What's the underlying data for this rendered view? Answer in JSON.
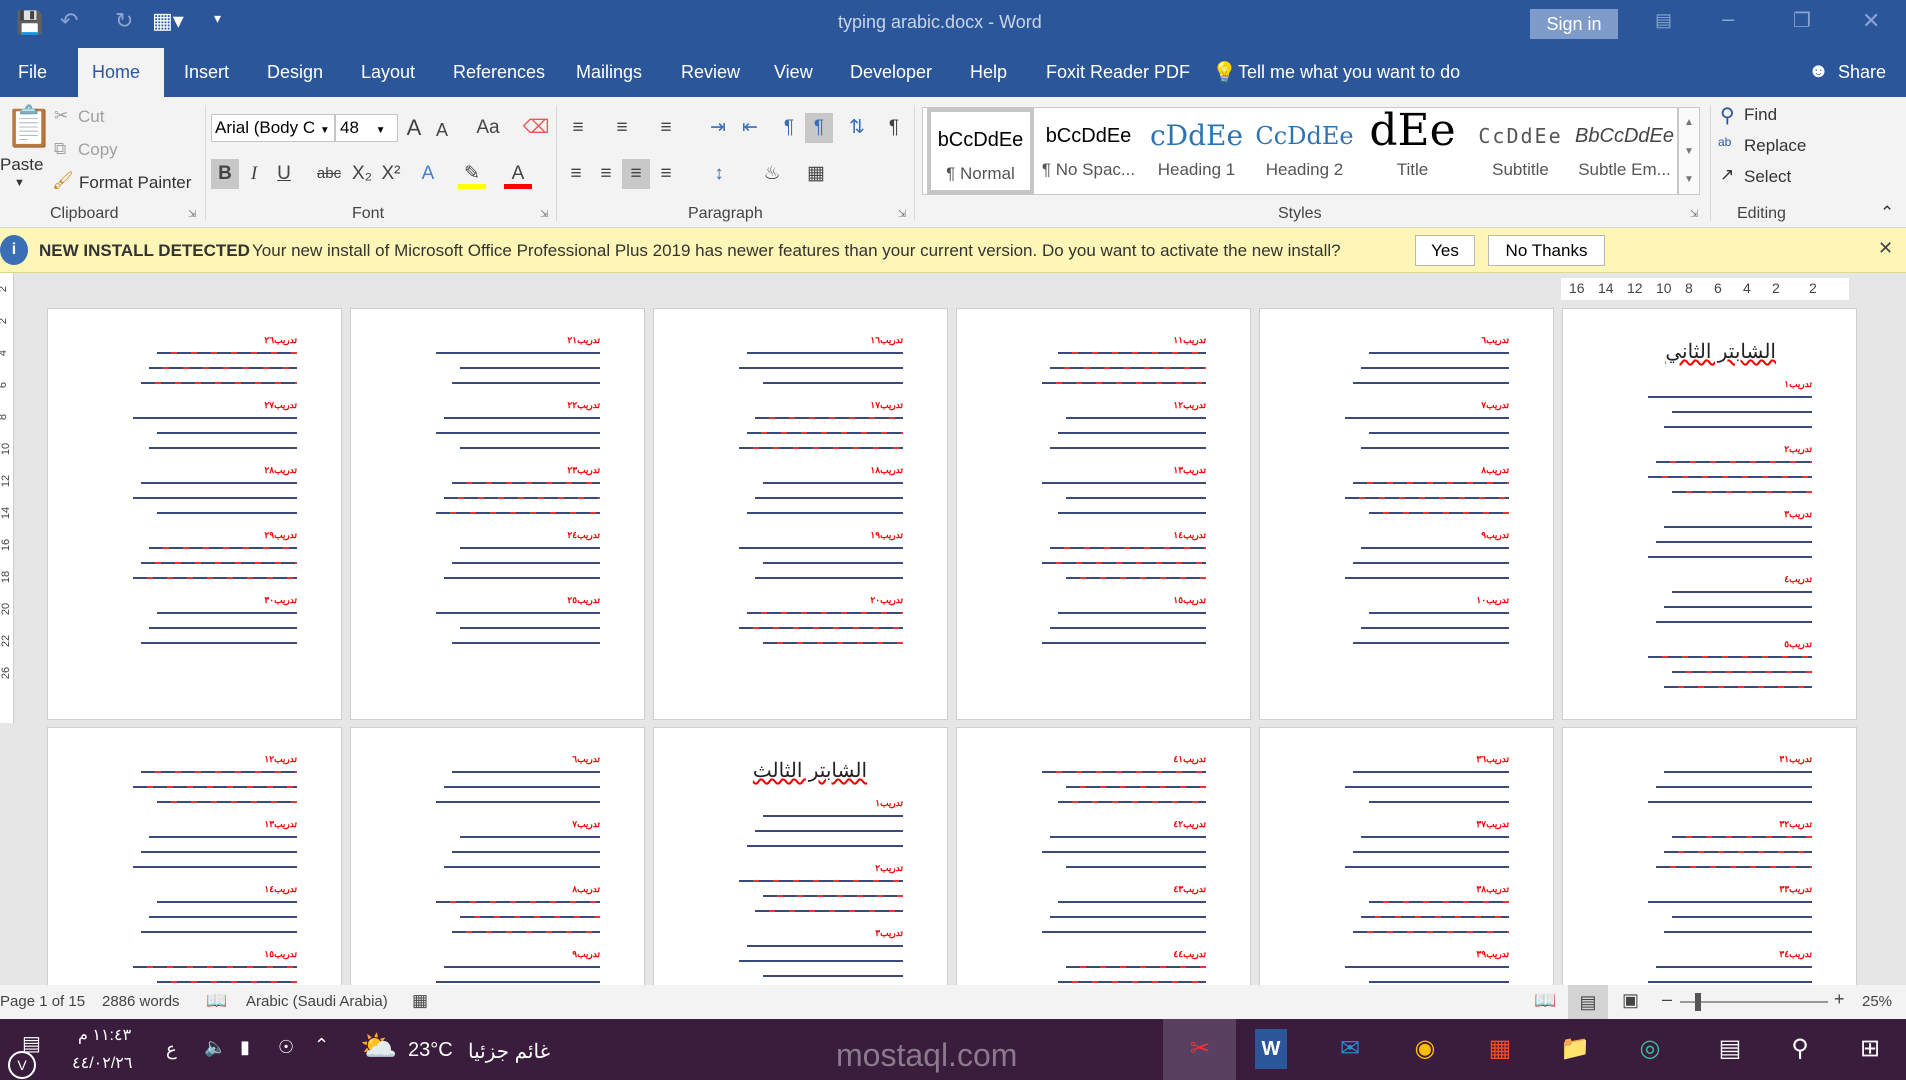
{
  "window": {
    "title": "typing arabic.docx  -  Word",
    "sign_in": "Sign in"
  },
  "tabs": [
    "File",
    "Home",
    "Insert",
    "Design",
    "Layout",
    "References",
    "Mailings",
    "Review",
    "View",
    "Developer",
    "Help",
    "Foxit Reader PDF"
  ],
  "tell_me": "Tell me what you want to do",
  "share": "Share",
  "clipboard": {
    "paste": "Paste",
    "cut": "Cut",
    "copy": "Copy",
    "format_painter": "Format Painter",
    "label": "Clipboard"
  },
  "font": {
    "name": "Arial (Body C",
    "size": "48",
    "label": "Font",
    "bold": "B",
    "italic": "I",
    "underline": "U",
    "strike": "abc",
    "grow": "A",
    "shrink": "A",
    "case": "Aa",
    "highlight_color": "#ffff00",
    "font_color": "#ff0000"
  },
  "paragraph": {
    "label": "Paragraph"
  },
  "styles": {
    "label": "Styles",
    "items": [
      {
        "preview": "bCcDdEe",
        "name": "¶ Normal"
      },
      {
        "preview": "bCcDdEe",
        "name": "¶ No Spac..."
      },
      {
        "preview": "cDdEe",
        "name": "Heading 1"
      },
      {
        "preview": "CcDdEe",
        "name": "Heading 2"
      },
      {
        "preview": "dEe",
        "name": "Title"
      },
      {
        "preview": "CcDdEe",
        "name": "Subtitle"
      },
      {
        "preview": "BbCcDdEe",
        "name": "Subtle Em..."
      }
    ]
  },
  "editing": {
    "find": "Find",
    "replace": "Replace",
    "select": "Select",
    "label": "Editing"
  },
  "notification": {
    "title": "NEW INSTALL DETECTED",
    "message": "Your new install of Microsoft Office Professional Plus 2019 has newer features than your current version. Do you want to activate the new install?",
    "yes": "Yes",
    "no": "No Thanks"
  },
  "ruler": {
    "numbers": [
      "16",
      "14",
      "12",
      "10",
      "8",
      "6",
      "4",
      "2",
      "2"
    ],
    "vertical": [
      "2",
      "2",
      "4",
      "6",
      "8",
      "10",
      "12",
      "14",
      "16",
      "18",
      "20",
      "22",
      "26"
    ]
  },
  "pages": [
    {
      "headings": [
        "تدريب٢٦",
        "تدريب٢٧",
        "تدريب٢٨",
        "تدريب٢٩",
        "تدريب٣٠"
      ]
    },
    {
      "headings": [
        "تدريب٢١",
        "تدريب٢٢",
        "تدريب٢٣",
        "تدريب٢٤",
        "تدريب٢٥"
      ]
    },
    {
      "headings": [
        "تدريب١٦",
        "تدريب١٧",
        "تدريب١٨",
        "تدريب١٩",
        "تدريب٢٠"
      ]
    },
    {
      "headings": [
        "تدريب١١",
        "تدريب١٢",
        "تدريب١٣",
        "تدريب١٤",
        "تدريب١٥"
      ]
    },
    {
      "headings": [
        "تدريب٦",
        "تدريب٧",
        "تدريب٨",
        "تدريب٩",
        "تدريب١٠"
      ]
    },
    {
      "title": "الشابتر الثاني",
      "headings": [
        "تدريب١",
        "تدريب٢",
        "تدريب٣",
        "تدريب٤",
        "تدريب٥"
      ]
    },
    {
      "headings": [
        "تدريب١٢",
        "تدريب١٣",
        "تدريب١٤",
        "تدريب١٥"
      ]
    },
    {
      "headings": [
        "تدريب٦",
        "تدريب٧",
        "تدريب٨",
        "تدريب٩"
      ]
    },
    {
      "title": "الشابتر الثالث",
      "headings": [
        "تدريب١",
        "تدريب٢",
        "تدريب٣"
      ]
    },
    {
      "headings": [
        "تدريب٤١",
        "تدريب٤٢",
        "تدريب٤٣",
        "تدريب٤٤"
      ]
    },
    {
      "headings": [
        "تدريب٣٦",
        "تدريب٣٧",
        "تدريب٣٨",
        "تدريب٣٩"
      ]
    },
    {
      "headings": [
        "تدريب٣١",
        "تدريب٣٢",
        "تدريب٣٣",
        "تدريب٣٤"
      ]
    }
  ],
  "status": {
    "page": "Page 1 of 15",
    "words": "2886 words",
    "language": "Arabic (Saudi Arabia)",
    "zoom": "25%",
    "zoom_level": 0.25
  },
  "taskbar": {
    "time": "١١:٤٣ م",
    "date": "٤٤/٠٢/٢٦",
    "lang": "ع",
    "temp": "23°C",
    "weather": "غائم جزئيا",
    "watermark": "mostaql.com"
  }
}
